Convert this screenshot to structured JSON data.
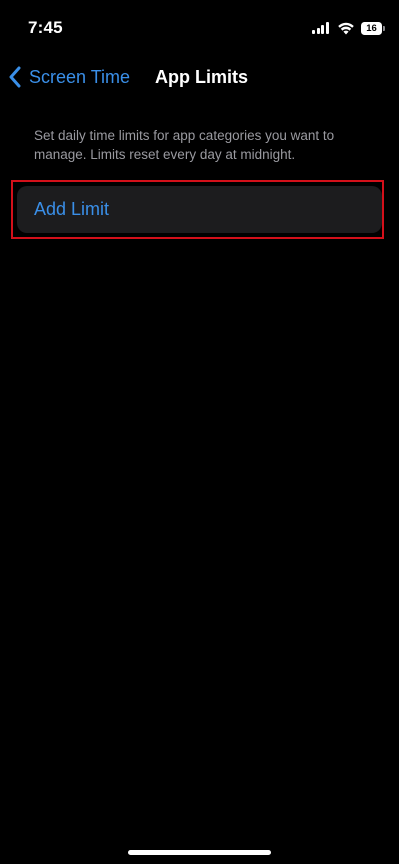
{
  "status_bar": {
    "time": "7:45",
    "battery_level": "16",
    "battery_fill_color": "#ffffff",
    "icons": [
      "signal-icon",
      "wifi-icon",
      "battery-icon"
    ]
  },
  "nav": {
    "back_label": "Screen Time",
    "title": "App Limits",
    "back_icon": "chevron-left-icon"
  },
  "description": "Set daily time limits for app categories you want to manage. Limits reset every day at midnight.",
  "add_limit": {
    "label": "Add Limit",
    "highlighted": true
  },
  "colors": {
    "background": "#000000",
    "accent": "#3a8fe8",
    "secondary_text": "#9a9aa0",
    "cell_background": "#1c1c1e",
    "highlight": "#d4101a"
  }
}
